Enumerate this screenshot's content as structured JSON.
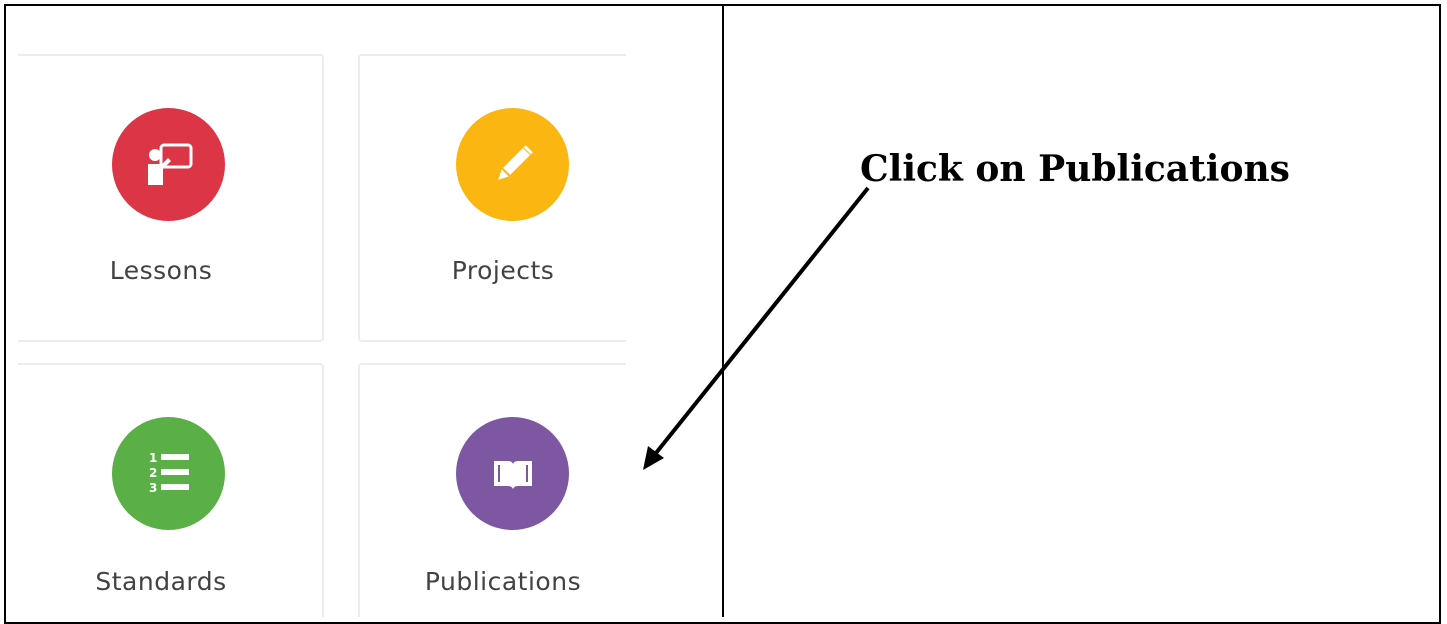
{
  "tiles": [
    {
      "label": "Lessons",
      "icon": "presentation-icon",
      "color": "#dc3545"
    },
    {
      "label": "Projects",
      "icon": "pencil-icon",
      "color": "#fbb612"
    },
    {
      "label": "Standards",
      "icon": "numbered-list-icon",
      "color": "#5aaf46"
    },
    {
      "label": "Publications",
      "icon": "open-book-icon",
      "color": "#7e57a3"
    }
  ],
  "annotation": {
    "text": "Click on Publications"
  }
}
